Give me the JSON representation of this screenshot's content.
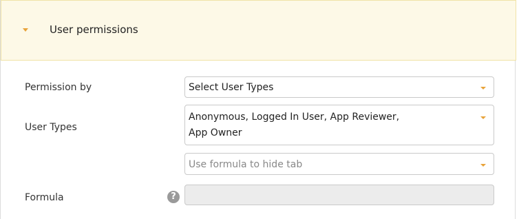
{
  "section": {
    "title": "User permissions",
    "expand_icon": "caret-down-icon"
  },
  "form": {
    "permission_by": {
      "label": "Permission by",
      "value": "Select User Types"
    },
    "user_types": {
      "label": "User Types",
      "value_line1": "Anonymous, Logged In User, App Reviewer,",
      "value_line2": "App Owner"
    },
    "hide_tab": {
      "placeholder": "Use formula to hide tab"
    },
    "formula": {
      "label": "Formula",
      "help_icon": "question-mark-icon",
      "help_glyph": "?",
      "value": ""
    }
  },
  "colors": {
    "header_background": "#fdf9e7",
    "accent_caret": "#e8a33a"
  }
}
